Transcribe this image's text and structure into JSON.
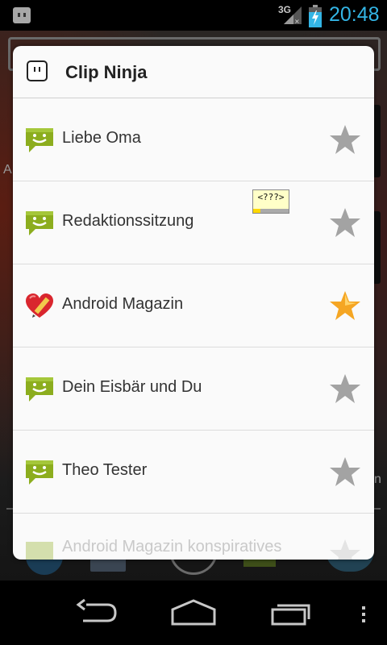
{
  "status_bar": {
    "network_type": "3G",
    "time": "20:48",
    "icons": [
      "notification-icon",
      "signal-icon",
      "battery-charging-icon"
    ]
  },
  "dialog": {
    "title": "Clip Ninja",
    "items": [
      {
        "label": "Liebe Oma",
        "icon": "sms-icon",
        "starred": false
      },
      {
        "label": "Redaktionssitzung",
        "icon": "sms-icon",
        "starred": false
      },
      {
        "label": "Android Magazin",
        "icon": "heart-pencil-icon",
        "starred": true
      },
      {
        "label": "Dein Eisbär und Du",
        "icon": "sms-icon",
        "starred": false
      },
      {
        "label": "Theo Tester",
        "icon": "sms-icon",
        "starred": false
      },
      {
        "label": "Android Magazin konspiratives",
        "icon": "sms-icon",
        "starred": false
      }
    ]
  },
  "tooltip": {
    "text": "<???>",
    "progress": 0.2
  },
  "background": {
    "left_letter": "A",
    "right_letter": "n"
  },
  "nav_bar": {
    "buttons": [
      "back-icon",
      "home-icon",
      "recent-apps-icon",
      "menu-icon"
    ]
  },
  "colors": {
    "accent": "#33b5e5",
    "sms_green": "#8cad1e",
    "star_gold": "#f5a623",
    "star_gray": "#a3a3a3"
  }
}
